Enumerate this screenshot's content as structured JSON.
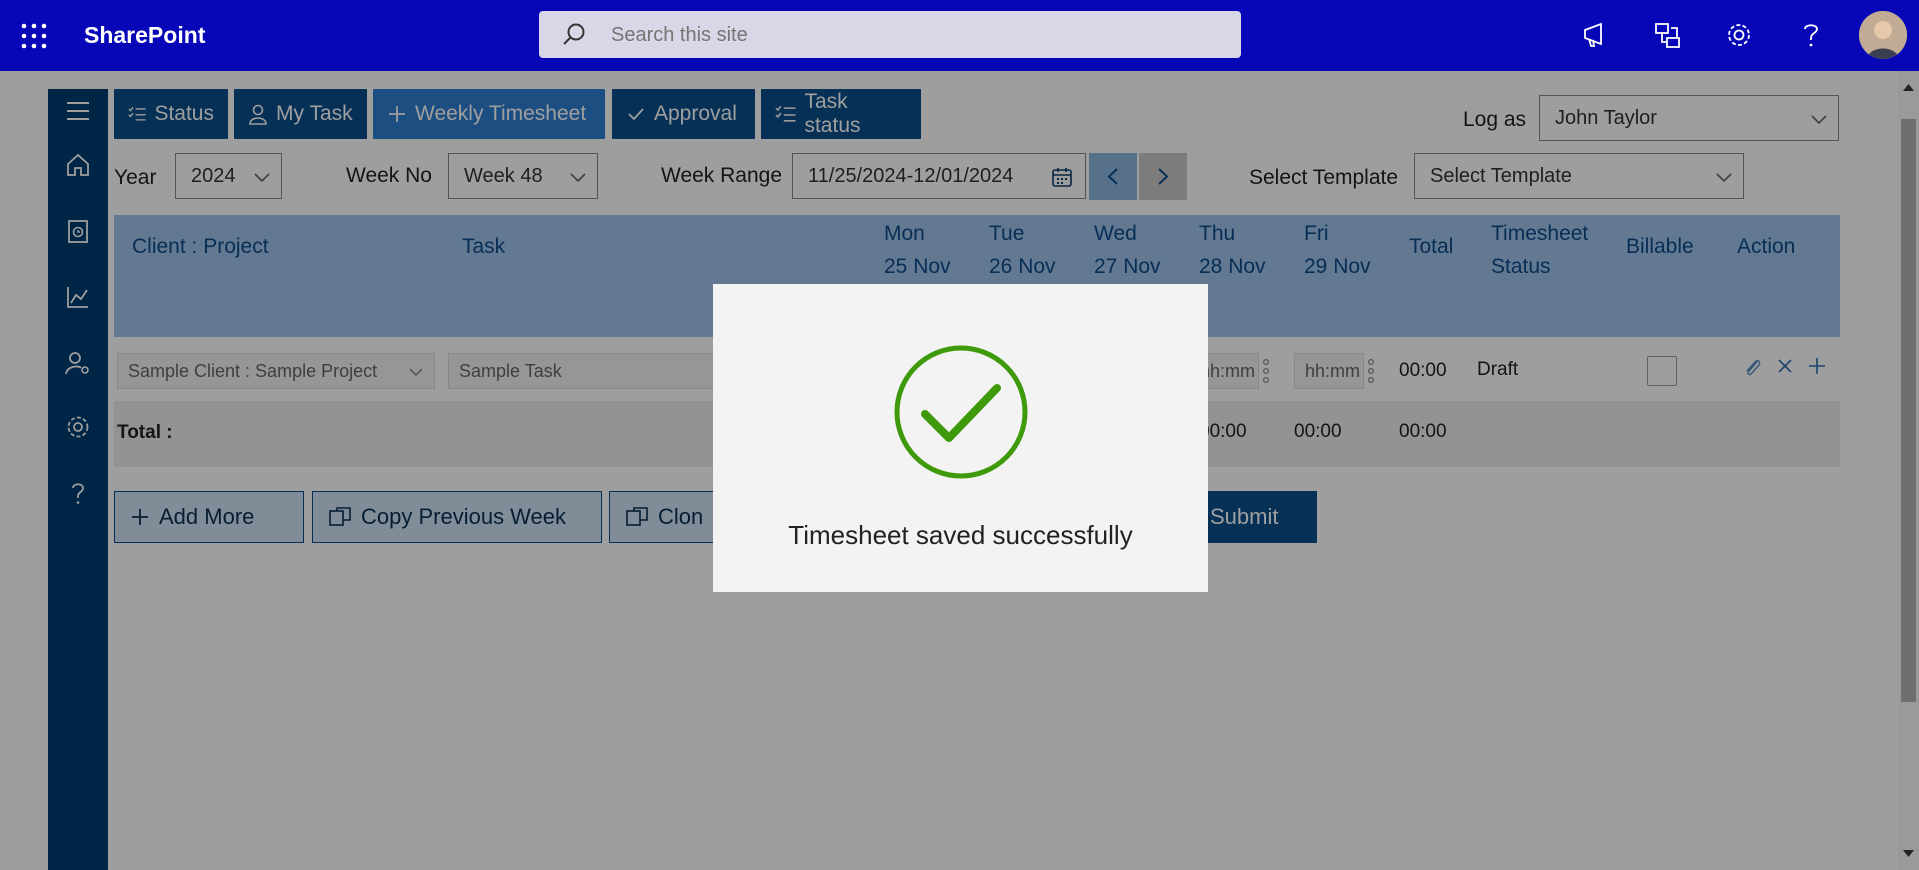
{
  "header": {
    "app_name": "SharePoint",
    "search_placeholder": "Search this site"
  },
  "tabs": [
    {
      "label": "Status"
    },
    {
      "label": "My Task"
    },
    {
      "label": "Weekly Timesheet"
    },
    {
      "label": "Approval"
    },
    {
      "label": "Task status"
    }
  ],
  "log_as": {
    "label": "Log as",
    "value": "John Taylor"
  },
  "filters": {
    "year_label": "Year",
    "year_value": "2024",
    "week_label": "Week No",
    "week_value": "Week 48",
    "range_label": "Week Range",
    "range_value": "11/25/2024-12/01/2024",
    "template_label": "Select Template",
    "template_value": "Select Template"
  },
  "grid": {
    "headers": {
      "client_project": "Client : Project",
      "task": "Task",
      "mon": "Mon",
      "mon_date": "25 Nov",
      "tue": "Tue",
      "tue_date": "26 Nov",
      "wed": "Wed",
      "wed_date": "27 Nov",
      "thu": "Thu",
      "thu_date": "28 Nov",
      "fri": "Fri",
      "fri_date": "29 Nov",
      "total": "Total",
      "ts_status_1": "Timesheet",
      "ts_status_2": "Status",
      "billable": "Billable",
      "action": "Action"
    },
    "row": {
      "client_project": "Sample Client : Sample Project",
      "task": "Sample Task",
      "thu_placeholder": "hh:mm",
      "fri_placeholder": "hh:mm",
      "total": "00:00",
      "status": "Draft"
    },
    "totals": {
      "label": "Total :",
      "thu": "00:00",
      "fri": "00:00",
      "total": "00:00"
    }
  },
  "actions": {
    "add_more": "Add More",
    "copy_prev": "Copy Previous Week",
    "clone": "Clon",
    "submit": "Submit"
  },
  "modal": {
    "message": "Timesheet saved successfully"
  },
  "colors": {
    "brand": "#0707b8",
    "primary": "#0a4e8c",
    "success": "#3e9a0a"
  }
}
